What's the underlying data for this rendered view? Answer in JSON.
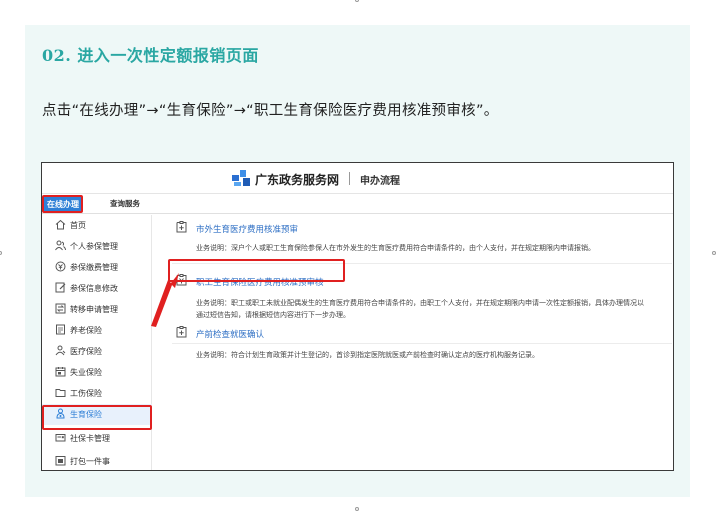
{
  "step": {
    "title": "02. 进入一次性定额报销页面",
    "description": "点击“在线办理”→“生育保险”→“职工生育保险医疗费用核准预审核”。"
  },
  "site": {
    "name": "广东政务服务网",
    "process_label": "申办流程"
  },
  "tabs": {
    "online": "在线办理",
    "query": "查询服务"
  },
  "sidebar": {
    "items": [
      {
        "label": "首页",
        "icon": "home-icon"
      },
      {
        "label": "个人参保管理",
        "icon": "people-icon"
      },
      {
        "label": "参保缴费管理",
        "icon": "coin-icon"
      },
      {
        "label": "参保信息修改",
        "icon": "edit-icon"
      },
      {
        "label": "转移申请管理",
        "icon": "transfer-icon"
      },
      {
        "label": "养老保险",
        "icon": "document-icon"
      },
      {
        "label": "医疗保险",
        "icon": "person-icon"
      },
      {
        "label": "失业保险",
        "icon": "calendar-icon"
      },
      {
        "label": "工伤保险",
        "icon": "folder-icon"
      },
      {
        "label": "生育保险",
        "icon": "baby-icon"
      },
      {
        "label": "社保卡管理",
        "icon": "card-icon"
      },
      {
        "label": "打包一件事",
        "icon": "package-icon"
      }
    ],
    "active_index": 9
  },
  "services": [
    {
      "title": "市外生育医疗费用核准预审",
      "desc": [
        "业务说明：深户个人或职工生育保险参保人在市外发生的生育医疗费用符合申请条件的，由个人支付，并在规定期限内申请报销。"
      ]
    },
    {
      "title": "职工生育保险医疗费用核准预审核",
      "desc": [
        "业务说明：职工或职工未就业配偶发生的生育医疗费用符合申请条件的，由职工个人支付，并在规定期限内申请一次性定额报销，具体办理情况以",
        "通过短信告知，请根据短信内容进行下一步办理。"
      ]
    },
    {
      "title": "产前检查就医确认",
      "desc": [
        "业务说明：符合计划生育政策并计生登记的，首诊到指定医院就医或产前检查时确认定点的医疗机构服务记录。"
      ]
    }
  ],
  "colors": {
    "accent_teal": "#2aa7a3",
    "highlight_red": "#e02020",
    "link_blue": "#2e6fc4",
    "tab_blue": "#2e7fd6"
  }
}
